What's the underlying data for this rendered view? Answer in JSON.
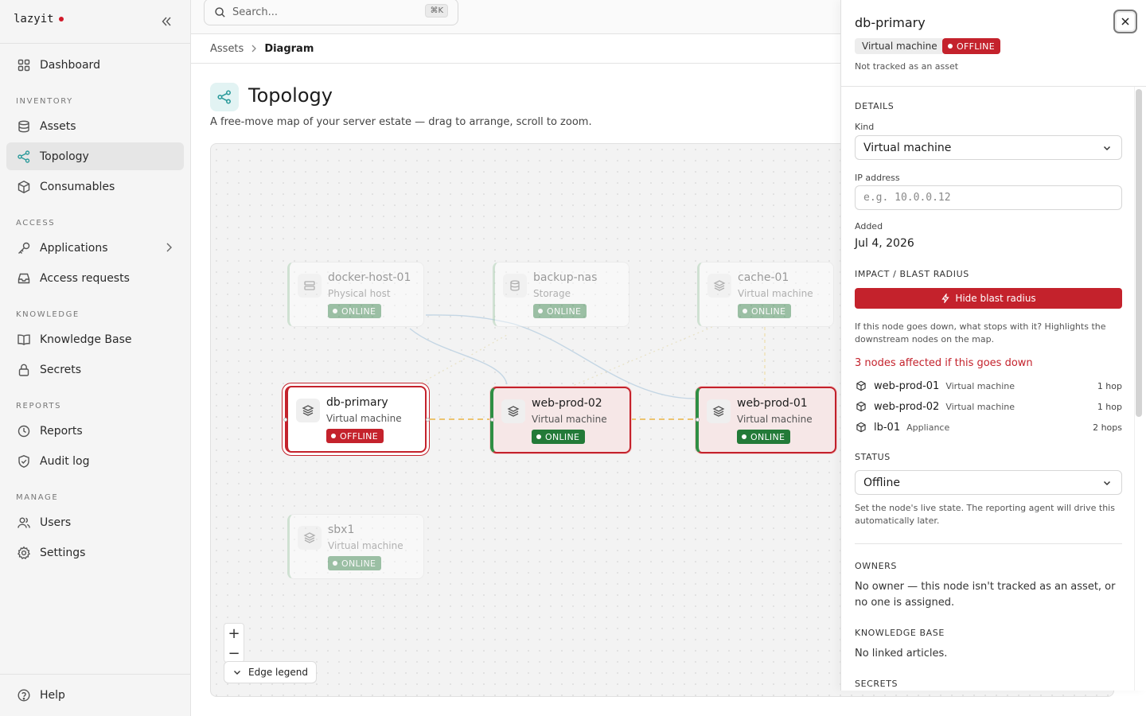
{
  "app": {
    "name": "lazyit"
  },
  "sidebar": {
    "dashboard": "Dashboard",
    "sections": {
      "inventory": "INVENTORY",
      "access": "ACCESS",
      "knowledge": "KNOWLEDGE",
      "reports": "REPORTS",
      "manage": "MANAGE"
    },
    "items": {
      "assets": "Assets",
      "topology": "Topology",
      "consumables": "Consumables",
      "applications": "Applications",
      "access_requests": "Access requests",
      "knowledge_base": "Knowledge Base",
      "secrets": "Secrets",
      "reports": "Reports",
      "audit_log": "Audit log",
      "users": "Users",
      "settings": "Settings"
    },
    "help": "Help"
  },
  "search": {
    "placeholder": "Search...",
    "shortcut": "⌘K"
  },
  "breadcrumb": {
    "parent": "Assets",
    "current": "Diagram"
  },
  "page": {
    "title": "Topology",
    "description": "A free-move map of your server estate — drag to arrange, scroll to zoom."
  },
  "nodes": [
    {
      "id": "docker-host-01",
      "name": "docker-host-01",
      "kind": "Physical host",
      "status": "ONLINE",
      "state": "dim"
    },
    {
      "id": "backup-nas",
      "name": "backup-nas",
      "kind": "Storage",
      "status": "ONLINE",
      "state": "dim"
    },
    {
      "id": "cache-01",
      "name": "cache-01",
      "kind": "Virtual machine",
      "status": "ONLINE",
      "state": "dim"
    },
    {
      "id": "db-primary",
      "name": "db-primary",
      "kind": "Virtual machine",
      "status": "OFFLINE",
      "state": "selected"
    },
    {
      "id": "web-prod-02",
      "name": "web-prod-02",
      "kind": "Virtual machine",
      "status": "ONLINE",
      "state": "affected"
    },
    {
      "id": "web-prod-01",
      "name": "web-prod-01",
      "kind": "Virtual machine",
      "status": "ONLINE",
      "state": "affected"
    },
    {
      "id": "sbx1",
      "name": "sbx1",
      "kind": "Virtual machine",
      "status": "ONLINE",
      "state": "dim"
    }
  ],
  "canvas_controls": {
    "zoom_in": "+",
    "zoom_out": "−",
    "legend": "Edge legend"
  },
  "panel": {
    "title": "db-primary",
    "kind_chip": "Virtual machine",
    "status_chip": "OFFLINE",
    "note": "Not tracked as an asset",
    "details_heading": "DETAILS",
    "kind_label": "Kind",
    "kind_value": "Virtual machine",
    "ip_label": "IP address",
    "ip_placeholder": "e.g. 10.0.0.12",
    "added_label": "Added",
    "added_value": "Jul 4, 2026",
    "impact_heading": "IMPACT / BLAST RADIUS",
    "blast_button": "Hide blast radius",
    "blast_help": "If this node goes down, what stops with it? Highlights the downstream nodes on the map.",
    "affected_heading": "3 nodes affected if this goes down",
    "affected": [
      {
        "name": "web-prod-01",
        "kind": "Virtual machine",
        "hops": "1 hop"
      },
      {
        "name": "web-prod-02",
        "kind": "Virtual machine",
        "hops": "1 hop"
      },
      {
        "name": "lb-01",
        "kind": "Appliance",
        "hops": "2 hops"
      }
    ],
    "status_heading": "STATUS",
    "status_value": "Offline",
    "status_help": "Set the node's live state. The reporting agent will drive this automatically later.",
    "owners_heading": "OWNERS",
    "owners_text": "No owner — this node isn't tracked as an asset, or no one is assigned.",
    "kb_heading": "KNOWLEDGE BASE",
    "kb_text": "No linked articles.",
    "secrets_heading": "SECRETS"
  },
  "colors": {
    "accent_red": "#c4222c",
    "online_green": "#237a38",
    "teal": "#2a9a9a"
  }
}
